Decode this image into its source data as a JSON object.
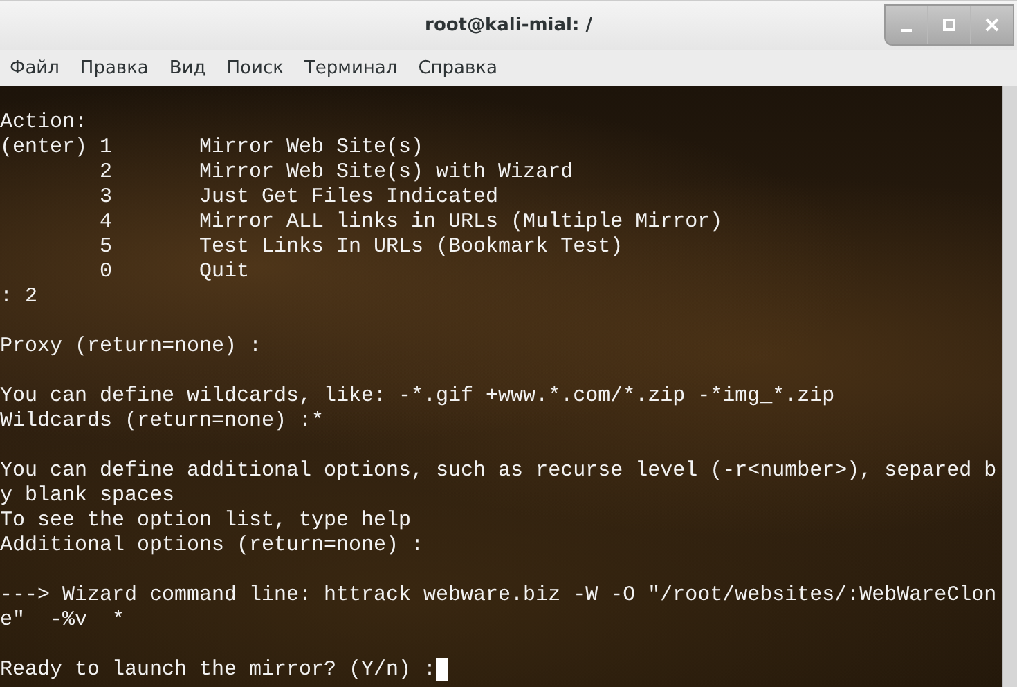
{
  "window": {
    "title": "root@kali-mial: /"
  },
  "window_controls": [
    {
      "kind": "minimize"
    },
    {
      "kind": "maximize"
    },
    {
      "kind": "close"
    }
  ],
  "menu": [
    "Файл",
    "Правка",
    "Вид",
    "Поиск",
    "Терминал",
    "Справка"
  ],
  "terminal": {
    "blocks": [
      [
        "Action:",
        "(enter) 1       Mirror Web Site(s)",
        "        2       Mirror Web Site(s) with Wizard",
        "        3       Just Get Files Indicated",
        "        4       Mirror ALL links in URLs (Multiple Mirror)",
        "        5       Test Links In URLs (Bookmark Test)",
        "        0       Quit",
        ": 2"
      ],
      [
        "Proxy (return=none) :"
      ],
      [
        "You can define wildcards, like: -*.gif +www.*.com/*.zip -*img_*.zip",
        "Wildcards (return=none) :*"
      ],
      [
        "You can define additional options, such as recurse level (-r<number>), separed b",
        "y blank spaces",
        "To see the option list, type help",
        "Additional options (return=none) :"
      ],
      [
        "---> Wizard command line: httrack webware.biz -W -O \"/root/websites/:WebWareClon",
        "e\"  -%v  *"
      ],
      [
        "Ready to launch the mirror? (Y/n) :"
      ]
    ],
    "cursor": true
  }
}
